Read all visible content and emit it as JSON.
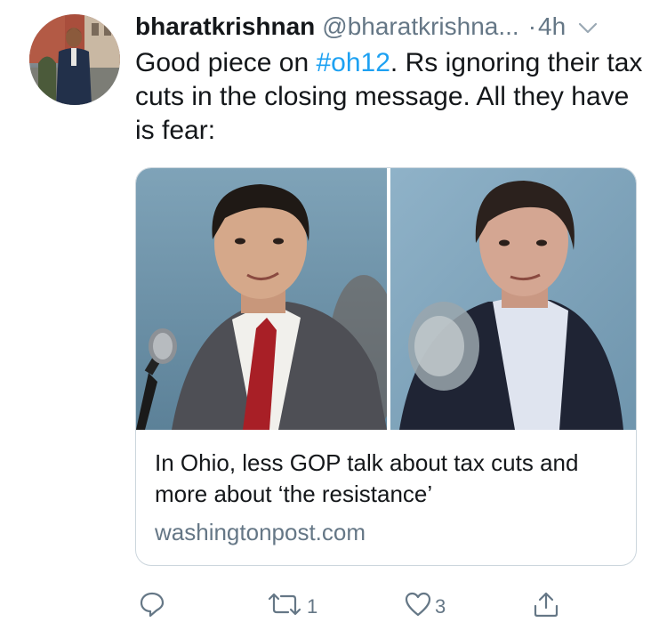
{
  "tweet": {
    "display_name": "bharatkrishnan",
    "handle": "@bharatkrishna...",
    "separator": "·",
    "time": "4h",
    "text_before": "Good piece on ",
    "hashtag": "#oh12",
    "text_after": ". Rs ignoring their tax cuts in the closing message. All they have is fear:"
  },
  "card": {
    "title": "In Ohio, less GOP talk about tax cuts and more about ‘the resistance’",
    "domain": "washingtonpost.com"
  },
  "actions": {
    "reply_icon": "reply-icon",
    "retweet_icon": "retweet-icon",
    "retweet_count": "1",
    "like_icon": "heart-icon",
    "like_count": "3",
    "share_icon": "share-icon"
  },
  "colors": {
    "link": "#1da1f2",
    "secondary_text": "#657786",
    "card_border": "#ccd6dd"
  }
}
